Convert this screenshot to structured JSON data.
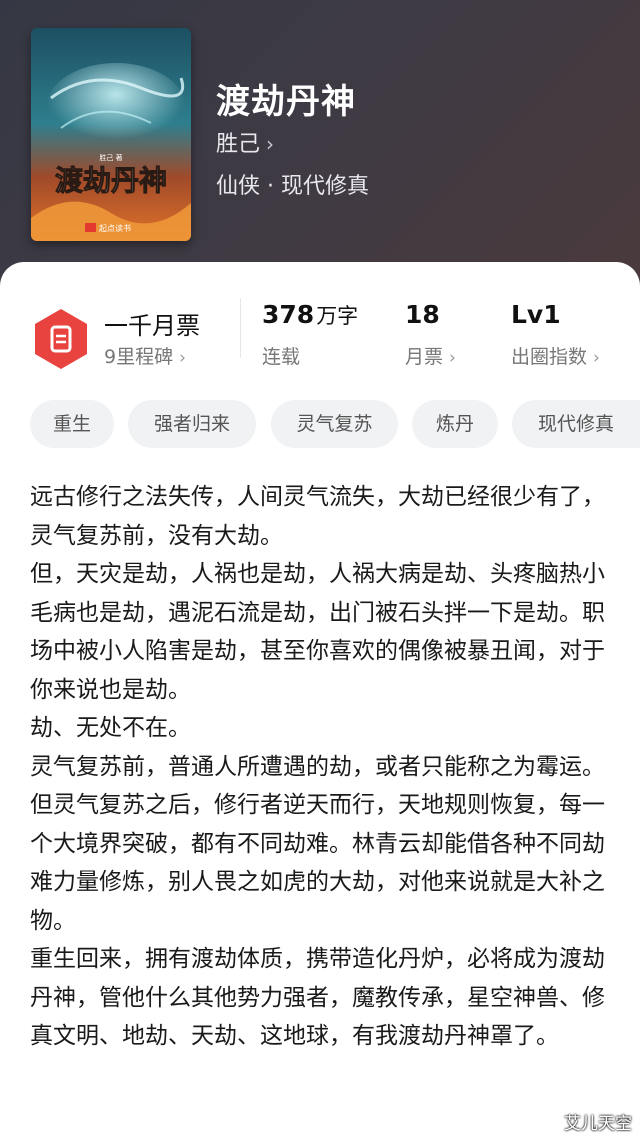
{
  "book": {
    "title": "渡劫丹神",
    "author": "胜己",
    "genre": "仙侠 · 现代修真",
    "cover": {
      "title": "渡劫丹神",
      "author_small": "胜己 著",
      "publisher": "起点读书"
    }
  },
  "stats": {
    "monthly_ticket_rank": {
      "main": "一千月票",
      "sub": "9里程碑"
    },
    "word_count": {
      "value": "378",
      "unit": "万字",
      "label": "连载"
    },
    "monthly_tickets": {
      "value": "18",
      "label": "月票"
    },
    "influence": {
      "value": "Lv1",
      "label": "出圈指数"
    }
  },
  "tags": [
    "重生",
    "强者归来",
    "灵气复苏",
    "炼丹",
    "现代修真"
  ],
  "synopsis": [
    "远古修行之法失传，人间灵气流失，大劫已经很少有了，灵气复苏前，没有大劫。",
    "但，天灾是劫，人祸也是劫，人祸大病是劫、头疼脑热小毛病也是劫，遇泥石流是劫，出门被石头拌一下是劫。职场中被小人陷害是劫，甚至你喜欢的偶像被暴丑闻，对于你来说也是劫。",
    "劫、无处不在。",
    "灵气复苏前，普通人所遭遇的劫，或者只能称之为霉运。",
    "但灵气复苏之后，修行者逆天而行，天地规则恢复，每一个大境界突破，都有不同劫难。林青云却能借各种不同劫难力量修炼，别人畏之如虎的大劫，对他来说就是大补之物。",
    "重生回来，拥有渡劫体质，携带造化丹炉，必将成为渡劫丹神，管他什么其他势力强者，魔教传承，星空神兽、修真文明、地劫、天劫、这地球，有我渡劫丹神罩了。"
  ],
  "watermark": "艾儿天空",
  "colors": {
    "badge_red": "#e8433f",
    "header_bg": "#3a3a44"
  },
  "icons": {
    "badge": "ticket-badge-icon",
    "chevron": "chevron-right-icon"
  }
}
